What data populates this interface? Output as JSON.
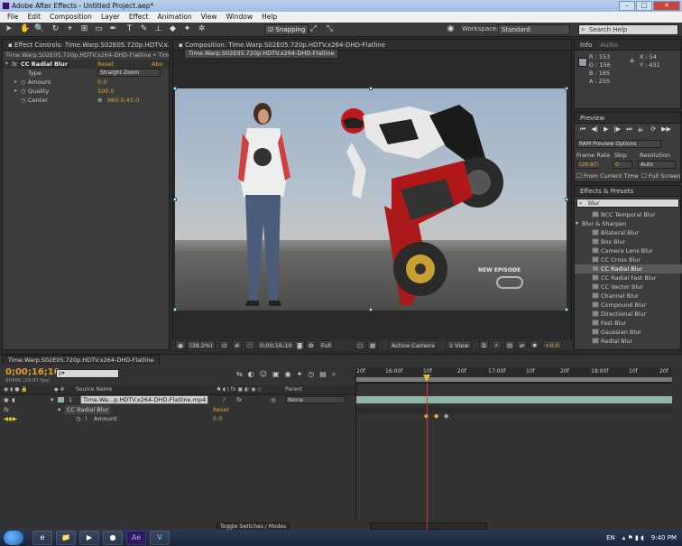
{
  "window": {
    "title": "Adobe After Effects - Untitled Project.aep*"
  },
  "menu": [
    "File",
    "Edit",
    "Composition",
    "Layer",
    "Effect",
    "Animation",
    "View",
    "Window",
    "Help"
  ],
  "toolbar": {
    "snapping_label": "Snapping",
    "workspace_label": "Workspace:",
    "workspace_value": "Standard",
    "search_help": "Search Help"
  },
  "effect_controls": {
    "tab_label": "Effect Controls: Time.Warp.S02E05.720p.HDTV.x264-DHD-Flatline",
    "sub_label": "Time.Warp.S02E05.720p.HDTV.x264-DHD-Flatline • Time.Warp.S02E05.720p.HDTV",
    "effect_name": "CC Radial Blur",
    "reset": "Reset",
    "about": "Abo",
    "props": [
      {
        "name": "Type",
        "value": "Straight Zoom",
        "kind": "dropdown"
      },
      {
        "name": "Amount",
        "value": "0.0"
      },
      {
        "name": "Quality",
        "value": "100.0"
      },
      {
        "name": "Center",
        "value": "960.0,43.0"
      }
    ]
  },
  "composition": {
    "tab_label": "Composition: Time.Warp.S02E05.720p.HDTV.x264-DHD-Flatline",
    "sub_tab": "Time.Warp.S02E05.720p.HDTV.x264-DHD-Flatline",
    "watermark": "NEW EPISODE",
    "zoom": "(38.2%)",
    "timecode": "0;00;16;10",
    "resolution": "Full",
    "camera": "Active Camera",
    "views": "1 View",
    "exposure": "+0.0"
  },
  "info": {
    "tab_label": "Info",
    "tab2_label": "Audio",
    "r": "R : 153",
    "g": "G : 156",
    "b": "B : 165",
    "a": "A : 255",
    "x": "X : 54",
    "y": "Y : 431"
  },
  "preview": {
    "tab_label": "Preview",
    "ram_options": "RAM Preview Options",
    "frame_rate_label": "Frame Rate",
    "skip_label": "Skip",
    "resolution_label": "Resolution",
    "frame_rate": "(29.97)",
    "skip": "0",
    "resolution": "Auto",
    "from_current": "From Current Time",
    "full_screen": "Full Screen"
  },
  "effects_presets": {
    "tab_label": "Effects & Presets",
    "search_value": "blur",
    "items": [
      {
        "label": "BCC Temporal Blur",
        "kind": "effect"
      },
      {
        "label": "Blur & Sharpen",
        "kind": "category"
      },
      {
        "label": "Bilateral Blur",
        "kind": "effect"
      },
      {
        "label": "Box Blur",
        "kind": "effect"
      },
      {
        "label": "Camera Lens Blur",
        "kind": "effect"
      },
      {
        "label": "CC Cross Blur",
        "kind": "effect"
      },
      {
        "label": "CC Radial Blur",
        "kind": "effect",
        "selected": true
      },
      {
        "label": "CC Radial Fast Blur",
        "kind": "effect"
      },
      {
        "label": "CC Vector Blur",
        "kind": "effect"
      },
      {
        "label": "Channel Blur",
        "kind": "effect"
      },
      {
        "label": "Compound Blur",
        "kind": "effect"
      },
      {
        "label": "Directional Blur",
        "kind": "effect"
      },
      {
        "label": "Fast Blur",
        "kind": "effect"
      },
      {
        "label": "Gaussian Blur",
        "kind": "effect"
      },
      {
        "label": "Radial Blur",
        "kind": "effect"
      }
    ]
  },
  "timeline": {
    "tab_label": "Time.Warp.S02E05.720p.HDTV.x264-DHD-Flatline",
    "timecode": "0;00;16;10",
    "fps": "00490 (29.97 fps)",
    "search_placeholder": "ρ▾",
    "col_source": "Source Name",
    "col_parent": "Parent",
    "layer_index": "1",
    "layer_name": "Time.Wa...p.HDTV.x264-DHD-Flatline.mp4",
    "parent_value": "None",
    "effect_name": "CC Radial Blur",
    "effect_reset": "Reset",
    "prop_name": "Amount",
    "prop_value": "0.0",
    "toggle_label": "Toggle Switches / Modes",
    "ruler_ticks": [
      "20f",
      "16:00f",
      "10f",
      "20f",
      "17:00f",
      "10f",
      "20f",
      "18:00f",
      "10f",
      "20f"
    ]
  },
  "taskbar": {
    "lang": "EN",
    "time": "9:40 PM",
    "apps": [
      "e",
      "📁",
      "▶",
      "●",
      "Ae",
      "V"
    ]
  },
  "colors": {
    "accent_orange": "#e0a030",
    "playhead": "#dd3333",
    "layer_bar": "#8fb4a8",
    "keyframe": "#e0c030"
  }
}
